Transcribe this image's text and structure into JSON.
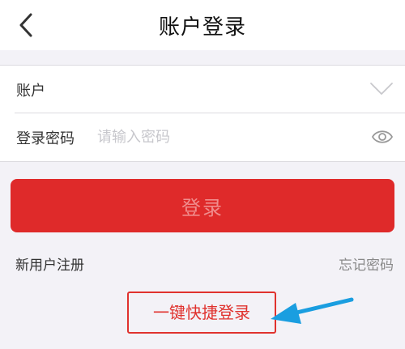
{
  "header": {
    "title": "账户登录",
    "back_icon": "chevron-left-icon"
  },
  "form": {
    "account_label": "账户",
    "account_value": "",
    "dropdown_icon": "chevron-down-icon",
    "password_label": "登录密码",
    "password_placeholder": "请输入密码",
    "visibility_icon": "eye-icon"
  },
  "actions": {
    "login_label": "登录",
    "register_label": "新用户注册",
    "forgot_label": "忘记密码",
    "quick_login_label": "一键快捷登录"
  },
  "annotation": {
    "arrow_icon": "blue-arrow-left-icon",
    "arrow_color": "#1a9ee0"
  },
  "colors": {
    "brand_red": "#df2a2a",
    "quick_border_red": "#e0322e",
    "background": "#f3f2f7"
  }
}
